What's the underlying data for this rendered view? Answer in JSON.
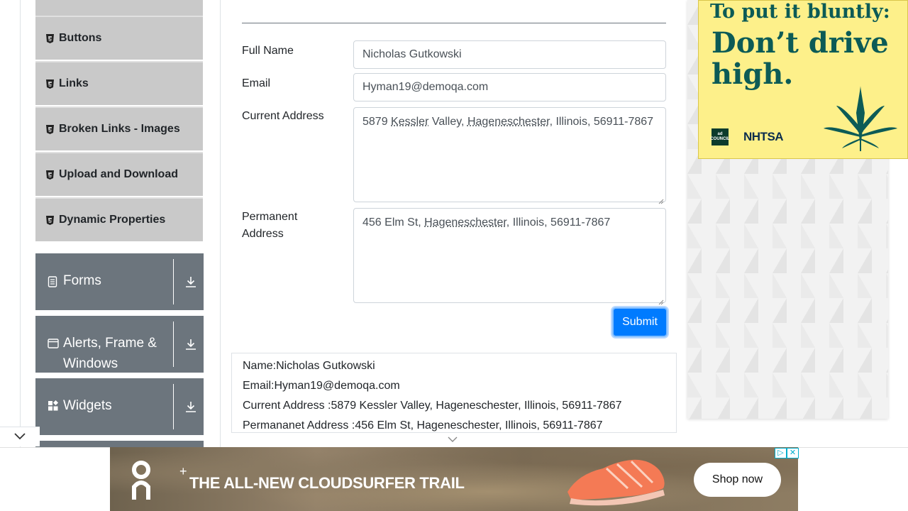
{
  "sidebar": {
    "elements_items": [
      {
        "label": "Buttons",
        "icon": "html5-icon"
      },
      {
        "label": "Links",
        "icon": "html5-icon"
      },
      {
        "label": "Broken Links - Images",
        "icon": "html5-icon"
      },
      {
        "label": "Upload and Download",
        "icon": "html5-icon"
      },
      {
        "label": "Dynamic Properties",
        "icon": "html5-icon"
      }
    ],
    "groups": [
      {
        "label": "Forms",
        "icon": "document-icon"
      },
      {
        "label": "Alerts, Frame & Windows",
        "icon": "window-icon"
      },
      {
        "label": "Widgets",
        "icon": "widgets-icon"
      }
    ]
  },
  "form": {
    "full_name_label": "Full Name",
    "full_name_value": "Nicholas Gutkowski",
    "email_label": "Email",
    "email_value": "Hyman19@demoqa.com",
    "current_address_label": "Current Address",
    "current_address_parts": [
      "5879 ",
      "Kessler",
      " Valley, ",
      "Hageneschester",
      ", Illinois, 56911-7867"
    ],
    "permanent_address_label": "Permanent Address",
    "permanent_address_parts": [
      "456 Elm St, ",
      "Hageneschester",
      ", Illinois, 56911-7867"
    ],
    "submit_label": "Submit"
  },
  "output": {
    "name": "Name:Nicholas Gutkowski",
    "email": "Email:Hyman19@demoqa.com",
    "current_address": "Current Address :5879 Kessler Valley, Hageneschester, Illinois, 56911-7867",
    "permanent_address": "Permananet Address :456 Elm St, Hageneschester, Illinois, 56911-7867"
  },
  "ads": {
    "right": {
      "line1": "To put it bluntly:",
      "line2": "Don’t drive high.",
      "sponsor1": "ad council",
      "sponsor2": "NHTSA"
    },
    "bottom": {
      "headline": "THE ALL-NEW CLOUDSURFER TRAIL",
      "cta": "Shop now"
    }
  },
  "colors": {
    "primary": "#007bff",
    "sidebar_group": "#6c757d",
    "sidebar_item": "#c9c9c9",
    "ad_yellow": "#fdf08a",
    "ad_green": "#0c5b56"
  }
}
